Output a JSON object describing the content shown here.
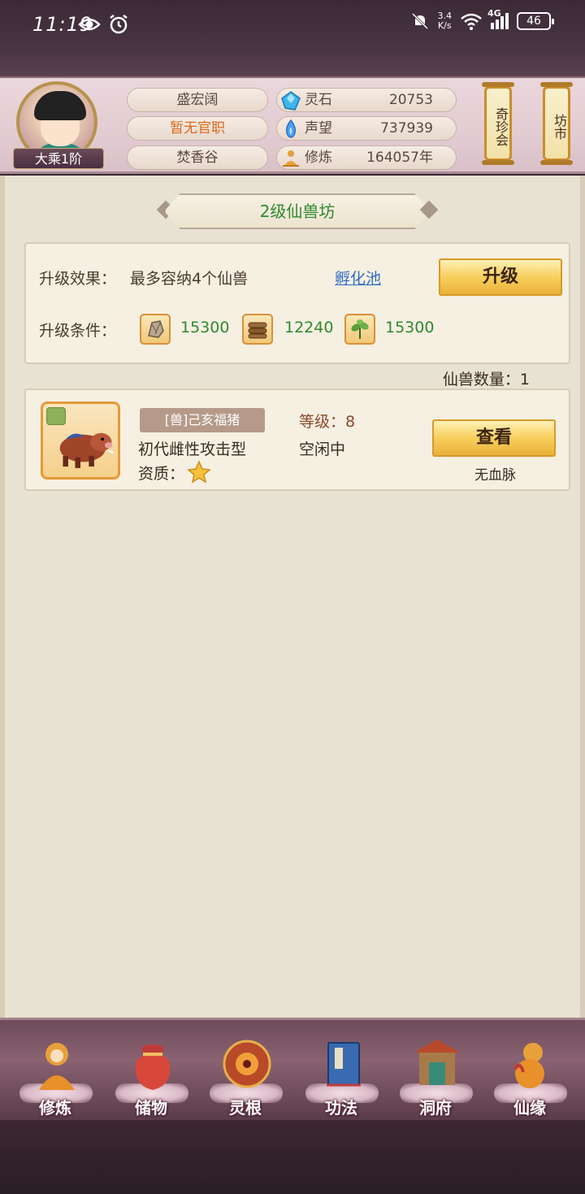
{
  "status_bar": {
    "time": "11:19",
    "net_speed_value": "3.4",
    "net_speed_unit": "K/s",
    "network_type": "4G",
    "battery": "46"
  },
  "player": {
    "name": "盛宏阔",
    "official_title": "暂无官职",
    "sect": "焚香谷",
    "rank": "大乘1阶"
  },
  "resources": [
    {
      "label": "灵石",
      "value": "20753",
      "icon": "spirit-stone-icon"
    },
    {
      "label": "声望",
      "value": "737939",
      "icon": "reputation-flame-icon"
    },
    {
      "label": "修炼",
      "value": "164057年",
      "icon": "meditation-icon"
    }
  ],
  "side_buttons": [
    {
      "label": "奇珍会"
    },
    {
      "label": "坊市"
    }
  ],
  "panel": {
    "title": "2级仙兽坊",
    "upgrade_effect_label": "升级效果：",
    "upgrade_effect_value": "最多容纳4个仙兽",
    "hatch_link": "孵化池",
    "upgrade_button": "升级",
    "upgrade_cost_label": "升级条件：",
    "costs": [
      {
        "icon": "ore-icon",
        "value": "15300"
      },
      {
        "icon": "wood-icon",
        "value": "12240"
      },
      {
        "icon": "herb-icon",
        "value": "15300"
      }
    ],
    "beast_count": "仙兽数量：1"
  },
  "beast": {
    "name_tag": "[兽]己亥福猪",
    "generation": "初代雌性攻击型",
    "quality_label": "资质：",
    "quality_stars": 1,
    "level": "等级：8",
    "status": "空闲中",
    "view_button": "查看",
    "bloodline": "无血脉"
  },
  "nav": [
    {
      "label": "修炼",
      "icon": "cultivation-icon"
    },
    {
      "label": "储物",
      "icon": "storage-bag-icon"
    },
    {
      "label": "灵根",
      "icon": "spirit-root-icon"
    },
    {
      "label": "功法",
      "icon": "technique-book-icon"
    },
    {
      "label": "洞府",
      "icon": "cave-mansion-icon"
    },
    {
      "label": "仙缘",
      "icon": "immortal-fate-icon"
    }
  ],
  "colors": {
    "accent_gold": "#f7cf5c",
    "green_text": "#2e8a2e",
    "link_blue": "#2f6cc4",
    "orange_text": "#d86a1a"
  }
}
